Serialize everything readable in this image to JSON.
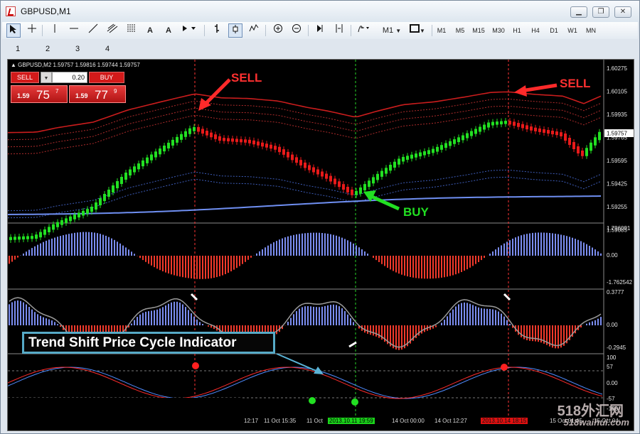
{
  "window": {
    "title": "GBPUSD,M1"
  },
  "window_buttons": {
    "minimize": "▁",
    "restore": "❐",
    "close": "✕"
  },
  "toolbar": {
    "timeframes": [
      "M1",
      "M5",
      "M15",
      "M30",
      "H1",
      "H4",
      "D1",
      "W1",
      "MN"
    ],
    "period_select": "M1",
    "text_tool": "A",
    "label_tool": "A"
  },
  "indicator_numbers": [
    "1",
    "2",
    "3",
    "4"
  ],
  "chart": {
    "symbol_line": "GBPUSD,M2  1.59757 1.59816 1.59744 1.59757",
    "trade_panel": {
      "sell_label": "SELL",
      "buy_label": "BUY",
      "lot": "0.20",
      "bid_prefix": "1.59",
      "bid_big": "75",
      "bid_sup": "7",
      "ask_prefix": "1.59",
      "ask_big": "77",
      "ask_sup": "9"
    },
    "price_axis": [
      "1.60275",
      "1.60105",
      "1.59935",
      "1.59765",
      "1.59595",
      "1.59425",
      "1.59255",
      "1.59085"
    ],
    "current_price": "1.59757",
    "osc1_axis": [
      "1.796091",
      "0.00",
      "-1.762542"
    ],
    "osc2_axis": [
      "0.3777",
      "0.00",
      "-0.2945"
    ],
    "osc3_axis": [
      "100",
      "57",
      "0.00",
      "-57",
      "-100"
    ],
    "time_labels": [
      "12:17",
      "11 Oct 15:35",
      "11 Oct",
      "2013.10.11 19:59",
      "14 Oct 00:00",
      "14 Oct 12:27",
      "2013.10.14 18:15",
      "15 Oct 01:45",
      "15 Oct 04:"
    ],
    "annotations": {
      "sell_left": "SELL",
      "sell_right": "SELL",
      "buy": "BUY",
      "indicator_title": "Trend Shift Price Cycle Indicator"
    },
    "colors": {
      "bull": "#22e022",
      "bear": "#e81a1a",
      "band": "#e02020",
      "baseline": "#6f8ff2"
    }
  },
  "watermark": {
    "line1": "518外汇网",
    "line2": "518waihui.com"
  }
}
